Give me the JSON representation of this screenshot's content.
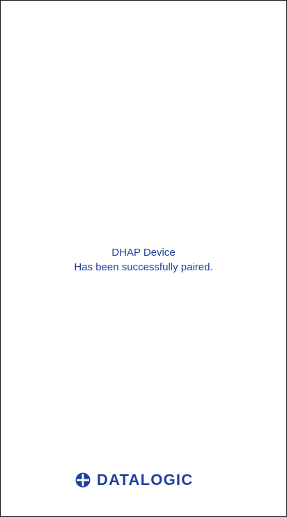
{
  "pairing": {
    "device_name": "DHAP Device",
    "status_message": "Has been successfully paired."
  },
  "brand": {
    "name": "DATALOGIC",
    "icon": "datalogic-logo-icon",
    "color": "#1f3f9b"
  }
}
